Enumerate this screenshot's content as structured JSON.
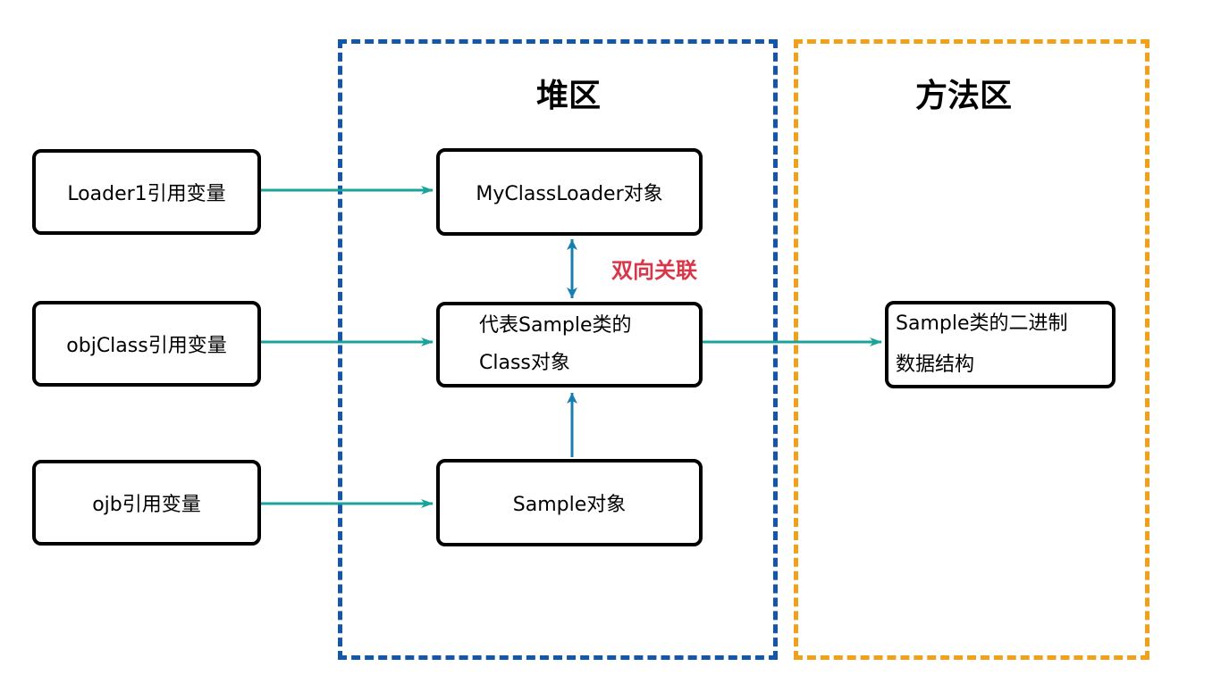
{
  "regions": {
    "heap": {
      "title": "堆区",
      "border_color": "#1456a8"
    },
    "method": {
      "title": "方法区",
      "border_color": "#f0a01a"
    }
  },
  "references": {
    "loader1": "Loader1引用变量",
    "objclass": "objClass引用变量",
    "ojb": "ojb引用变量"
  },
  "heap_objects": {
    "myclassloader": "MyClassLoader对象",
    "class_object_line1": "代表Sample类的",
    "class_object_line2": "Class对象",
    "sample": "Sample对象"
  },
  "method_area": {
    "binary_line1": "Sample类的二进制",
    "binary_line2": "数据结构"
  },
  "association_label": "双向关联",
  "colors": {
    "reference_arrow": "#1aa39a",
    "internal_arrow": "#1a7fb0",
    "association_text": "#d9364a"
  }
}
